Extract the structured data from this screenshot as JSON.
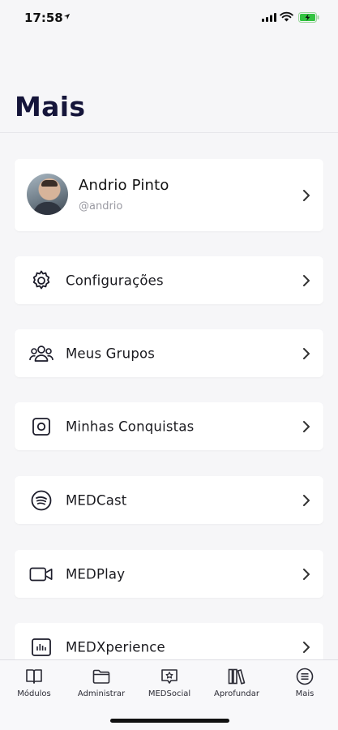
{
  "status_bar": {
    "time": "17:58"
  },
  "header": {
    "title": "Mais"
  },
  "profile": {
    "name": "Andrio Pinto",
    "handle": "@andrio"
  },
  "menu": [
    {
      "label": "Configurações",
      "icon": "gear-icon"
    },
    {
      "label": "Meus Grupos",
      "icon": "group-icon"
    },
    {
      "label": "Minhas Conquistas",
      "icon": "badge-icon"
    },
    {
      "label": "MEDCast",
      "icon": "podcast-icon"
    },
    {
      "label": "MEDPlay",
      "icon": "video-camera-icon"
    },
    {
      "label": "MEDXperience",
      "icon": "bar-chart-icon"
    }
  ],
  "tabs": [
    {
      "label": "Módulos",
      "icon": "book-icon"
    },
    {
      "label": "Administrar",
      "icon": "folder-icon"
    },
    {
      "label": "MEDSocial",
      "icon": "chat-star-icon"
    },
    {
      "label": "Aprofundar",
      "icon": "library-icon"
    },
    {
      "label": "Mais",
      "icon": "menu-circle-icon"
    }
  ]
}
